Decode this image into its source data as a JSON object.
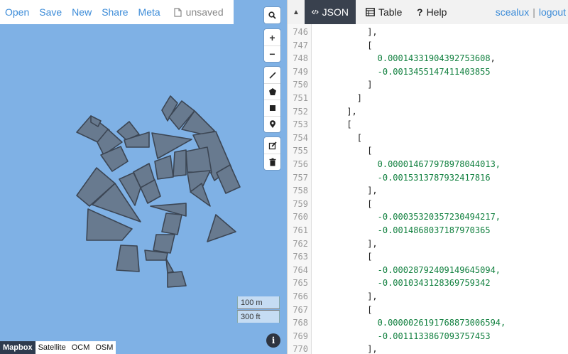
{
  "menu": {
    "items": [
      "Open",
      "Save",
      "New",
      "Share",
      "Meta"
    ],
    "file_status": "unsaved"
  },
  "map_controls": {
    "search_icon": "search-icon",
    "zoom_in": "+",
    "zoom_out": "−",
    "draw_tools": [
      "draw-line-icon",
      "draw-polygon-icon",
      "draw-rectangle-icon",
      "draw-marker-icon"
    ],
    "edit_tools": [
      "edit-layers-icon",
      "delete-layers-icon"
    ]
  },
  "scale": {
    "metric": "100 m",
    "imperial": "300 ft"
  },
  "info_label": "i",
  "layers": [
    {
      "label": "Mapbox",
      "active": true
    },
    {
      "label": "Satellite",
      "active": false
    },
    {
      "label": "OCM",
      "active": false
    },
    {
      "label": "OSM",
      "active": false
    }
  ],
  "tabs": [
    {
      "label": "JSON",
      "icon": "code-icon",
      "active": true
    },
    {
      "label": "Table",
      "icon": "table-icon",
      "active": false
    },
    {
      "label": "Help",
      "icon": "question-icon",
      "active": false
    }
  ],
  "user": {
    "name": "scealux",
    "separator": "|",
    "logout": "logout"
  },
  "editor_lines": [
    {
      "n": "746",
      "indent": 10,
      "text": "],",
      "kind": "p"
    },
    {
      "n": "747",
      "indent": 10,
      "text": "[",
      "kind": "p"
    },
    {
      "n": "748",
      "indent": 12,
      "text": "0.00014331904392753608",
      "suffix": ",",
      "kind": "n"
    },
    {
      "n": "749",
      "indent": 12,
      "text": "-0.001345514741140385",
      "suffix": "5",
      "kind": "n"
    },
    {
      "n": "750",
      "indent": 10,
      "text": "]",
      "kind": "p"
    },
    {
      "n": "751",
      "indent": 8,
      "text": "]",
      "kind": "p"
    },
    {
      "n": "752",
      "indent": 6,
      "text": "],",
      "kind": "p"
    },
    {
      "n": "753",
      "indent": 6,
      "text": "[",
      "kind": "p"
    },
    {
      "n": "754",
      "indent": 8,
      "text": "[",
      "kind": "p"
    },
    {
      "n": "755",
      "indent": 10,
      "text": "[",
      "kind": "p"
    },
    {
      "n": "756",
      "indent": 12,
      "text": "0.00001467797897804401",
      "suffix": "3,",
      "kind": "n"
    },
    {
      "n": "757",
      "indent": 12,
      "text": "-0.0015313787932417816",
      "suffix": "",
      "kind": "n"
    },
    {
      "n": "758",
      "indent": 10,
      "text": "],",
      "kind": "p"
    },
    {
      "n": "759",
      "indent": 10,
      "text": "[",
      "kind": "p"
    },
    {
      "n": "760",
      "indent": 12,
      "text": "-0.0003532035723049421",
      "suffix": "7,",
      "kind": "n"
    },
    {
      "n": "761",
      "indent": 12,
      "text": "-0.0014868037187970365",
      "suffix": "",
      "kind": "n"
    },
    {
      "n": "762",
      "indent": 10,
      "text": "],",
      "kind": "p"
    },
    {
      "n": "763",
      "indent": 10,
      "text": "[",
      "kind": "p"
    },
    {
      "n": "764",
      "indent": 12,
      "text": "-0.0002879240914964509",
      "suffix": "4,",
      "kind": "n"
    },
    {
      "n": "765",
      "indent": 12,
      "text": "-0.0010343128369759342",
      "suffix": "",
      "kind": "n"
    },
    {
      "n": "766",
      "indent": 10,
      "text": "],",
      "kind": "p"
    },
    {
      "n": "767",
      "indent": 10,
      "text": "[",
      "kind": "p"
    },
    {
      "n": "768",
      "indent": 12,
      "text": "0.00000261917688730065",
      "suffix": "94,",
      "kind": "n"
    },
    {
      "n": "769",
      "indent": 12,
      "text": "-0.0011133867093757453",
      "suffix": "",
      "kind": "n"
    },
    {
      "n": "770",
      "indent": 10,
      "text": "],",
      "kind": "p"
    }
  ],
  "colors": {
    "water": "#7fb1e5",
    "shape_fill": "#687a8f",
    "shape_stroke": "#3c4654",
    "link": "#3b8bd8",
    "active_tab": "#39414e",
    "number": "#11803f"
  }
}
